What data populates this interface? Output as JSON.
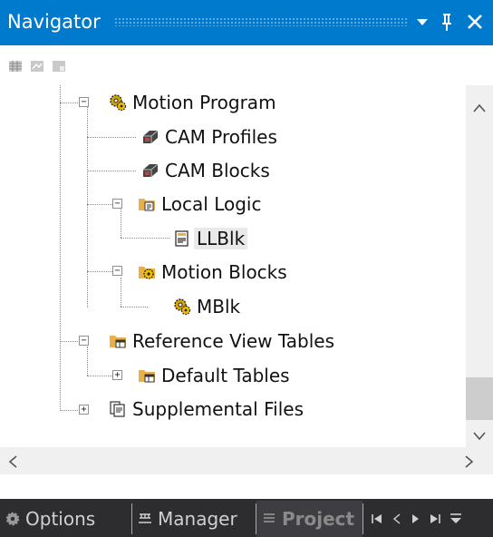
{
  "titlebar": {
    "title": "Navigator",
    "dropdown_icon": "triangle-down",
    "pin_icon": "pin",
    "close_icon": "close"
  },
  "mini_toolbar": {
    "icons": [
      "grid-view-icon",
      "property-view-icon",
      "split-view-icon"
    ]
  },
  "tree": {
    "items": [
      {
        "label": "Motion Program",
        "icon": "gear-program-icon",
        "expander": "−",
        "selected": false
      },
      {
        "label": "CAM Profiles",
        "icon": "cam-icon",
        "expander": "",
        "selected": false
      },
      {
        "label": "CAM Blocks",
        "icon": "cam-icon",
        "expander": "",
        "selected": false
      },
      {
        "label": "Local Logic",
        "icon": "folder-logic-icon",
        "expander": "−",
        "selected": false
      },
      {
        "label": "LLBlk",
        "icon": "logic-block-icon",
        "expander": "",
        "selected": true
      },
      {
        "label": "Motion Blocks",
        "icon": "folder-gear-icon",
        "expander": "−",
        "selected": false
      },
      {
        "label": "MBlk",
        "icon": "gear-program-icon",
        "expander": "",
        "selected": false
      },
      {
        "label": "Reference View Tables",
        "icon": "folder-table-icon",
        "expander": "−",
        "selected": false
      },
      {
        "label": "Default Tables",
        "icon": "folder-table-icon",
        "expander": "+",
        "selected": false
      },
      {
        "label": "Supplemental Files",
        "icon": "files-icon",
        "expander": "+",
        "selected": false
      }
    ]
  },
  "scrollbars": {
    "vertical_thumb_position": 0.88,
    "horizontal_thumb_fraction": 1.0
  },
  "tabs": {
    "options_label": "Options",
    "manager_label": "Manager",
    "project_label": "Project",
    "active_tab": "Project"
  },
  "tab_nav_icons": [
    "first-icon",
    "prev-icon",
    "next-icon",
    "last-icon",
    "menu-icon"
  ],
  "colors": {
    "title_bg": "#007acc",
    "tab_strip_bg": "#2d2d30",
    "active_tab_bg": "#3e3e42",
    "folder": "#e8b04a",
    "gear": "#d9a300"
  }
}
